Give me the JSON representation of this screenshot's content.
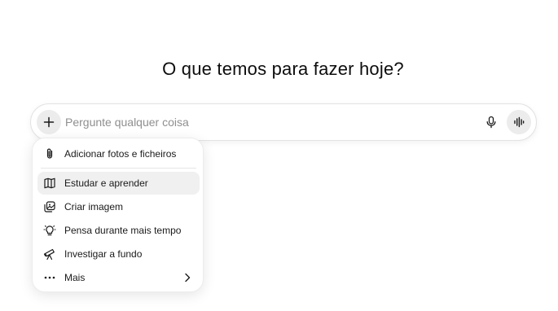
{
  "heading": "O que temos para fazer hoje?",
  "composer": {
    "placeholder": "Pergunte qualquer coisa",
    "value": "",
    "icons": {
      "add": "plus-icon",
      "dictate": "microphone-icon",
      "voice": "voice-waveform-icon"
    }
  },
  "menu": {
    "items": [
      {
        "label": "Adicionar fotos e ficheiros",
        "icon": "paperclip-icon"
      },
      {
        "label": "Estudar e aprender",
        "icon": "book-icon",
        "highlighted": true
      },
      {
        "label": "Criar imagem",
        "icon": "image-icon"
      },
      {
        "label": "Pensa durante mais tempo",
        "icon": "lightbulb-icon"
      },
      {
        "label": "Investigar a fundo",
        "icon": "telescope-icon"
      },
      {
        "label": "Mais",
        "icon": "more-dots-icon",
        "submenu": true
      }
    ]
  },
  "colors": {
    "text": "#0d0d0d",
    "placeholder": "#8f8f8f",
    "button_bg": "#ececec",
    "menu_highlight": "#f0f0f0",
    "border": "#e3e3e3"
  }
}
